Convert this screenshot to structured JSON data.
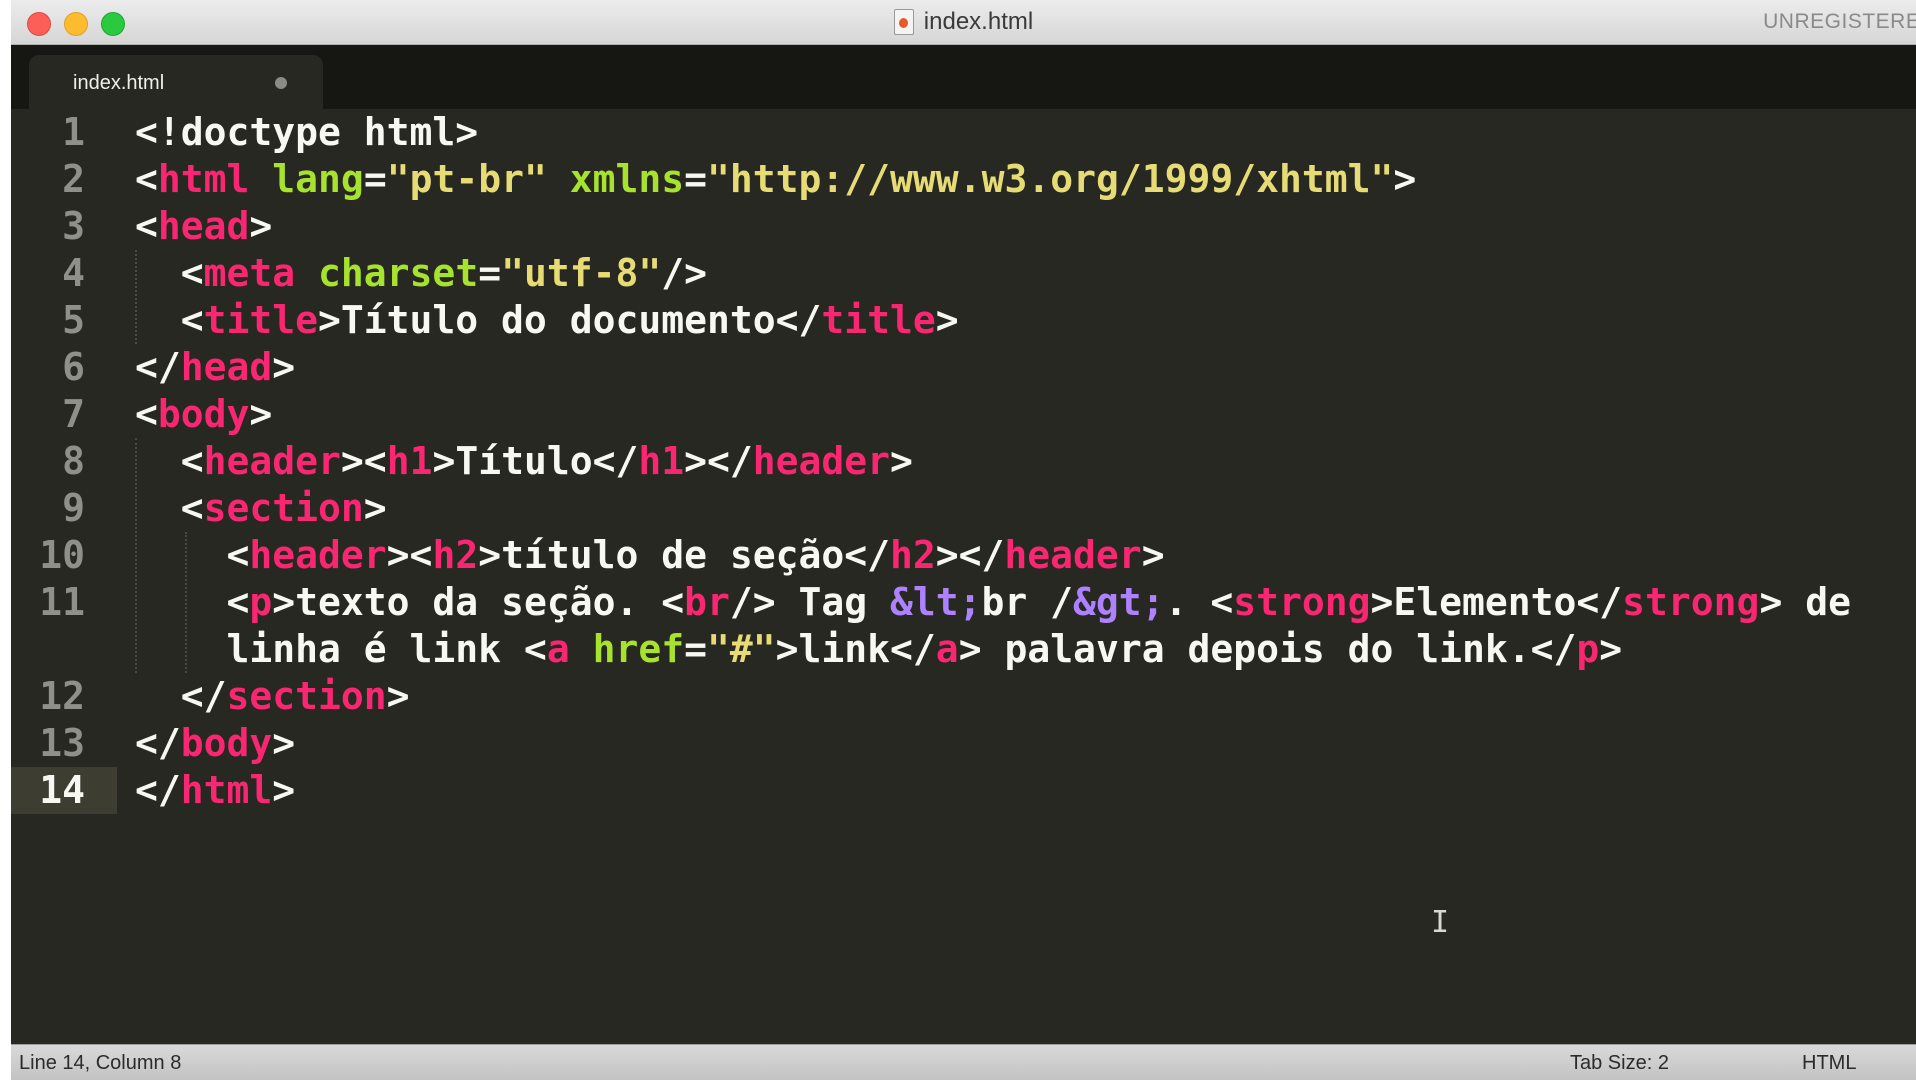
{
  "window": {
    "title": "index.html",
    "registration_label": "UNREGISTERED"
  },
  "tabs": [
    {
      "label": "index.html",
      "modified": true
    }
  ],
  "editor": {
    "active_line": 14,
    "lines": [
      {
        "number": "1",
        "tokens": [
          {
            "t": "<!doctype html>",
            "c": "text"
          }
        ]
      },
      {
        "number": "2",
        "tokens": [
          {
            "t": "<",
            "c": "text"
          },
          {
            "t": "html",
            "c": "tag"
          },
          {
            "t": " ",
            "c": "text"
          },
          {
            "t": "lang",
            "c": "attr"
          },
          {
            "t": "=",
            "c": "text"
          },
          {
            "t": "\"pt-br\"",
            "c": "string"
          },
          {
            "t": " ",
            "c": "text"
          },
          {
            "t": "xmlns",
            "c": "attr"
          },
          {
            "t": "=",
            "c": "text"
          },
          {
            "t": "\"http://www.w3.org/1999/xhtml\"",
            "c": "string"
          },
          {
            "t": ">",
            "c": "text"
          }
        ]
      },
      {
        "number": "3",
        "tokens": [
          {
            "t": "<",
            "c": "text"
          },
          {
            "t": "head",
            "c": "tag"
          },
          {
            "t": ">",
            "c": "text"
          }
        ]
      },
      {
        "number": "4",
        "tokens": [
          {
            "t": "  <",
            "c": "text"
          },
          {
            "t": "meta",
            "c": "tag"
          },
          {
            "t": " ",
            "c": "text"
          },
          {
            "t": "charset",
            "c": "attr"
          },
          {
            "t": "=",
            "c": "text"
          },
          {
            "t": "\"utf-8\"",
            "c": "string"
          },
          {
            "t": "/>",
            "c": "text"
          }
        ]
      },
      {
        "number": "5",
        "tokens": [
          {
            "t": "  <",
            "c": "text"
          },
          {
            "t": "title",
            "c": "tag"
          },
          {
            "t": ">Título do documento</",
            "c": "text"
          },
          {
            "t": "title",
            "c": "tag"
          },
          {
            "t": ">",
            "c": "text"
          }
        ]
      },
      {
        "number": "6",
        "tokens": [
          {
            "t": "</",
            "c": "text"
          },
          {
            "t": "head",
            "c": "tag"
          },
          {
            "t": ">",
            "c": "text"
          }
        ]
      },
      {
        "number": "7",
        "tokens": [
          {
            "t": "<",
            "c": "text"
          },
          {
            "t": "body",
            "c": "tag"
          },
          {
            "t": ">",
            "c": "text"
          }
        ]
      },
      {
        "number": "8",
        "tokens": [
          {
            "t": "  <",
            "c": "text"
          },
          {
            "t": "header",
            "c": "tag"
          },
          {
            "t": "><",
            "c": "text"
          },
          {
            "t": "h1",
            "c": "tag"
          },
          {
            "t": ">Título</",
            "c": "text"
          },
          {
            "t": "h1",
            "c": "tag"
          },
          {
            "t": "></",
            "c": "text"
          },
          {
            "t": "header",
            "c": "tag"
          },
          {
            "t": ">",
            "c": "text"
          }
        ]
      },
      {
        "number": "9",
        "tokens": [
          {
            "t": "  <",
            "c": "text"
          },
          {
            "t": "section",
            "c": "tag"
          },
          {
            "t": ">",
            "c": "text"
          }
        ]
      },
      {
        "number": "10",
        "tokens": [
          {
            "t": "    <",
            "c": "text"
          },
          {
            "t": "header",
            "c": "tag"
          },
          {
            "t": "><",
            "c": "text"
          },
          {
            "t": "h2",
            "c": "tag"
          },
          {
            "t": ">título de seção</",
            "c": "text"
          },
          {
            "t": "h2",
            "c": "tag"
          },
          {
            "t": "></",
            "c": "text"
          },
          {
            "t": "header",
            "c": "tag"
          },
          {
            "t": ">",
            "c": "text"
          }
        ]
      },
      {
        "number": "11",
        "tokens": [
          {
            "t": "    <",
            "c": "text"
          },
          {
            "t": "p",
            "c": "tag"
          },
          {
            "t": ">texto da seção. <",
            "c": "text"
          },
          {
            "t": "br",
            "c": "tag"
          },
          {
            "t": "/> Tag ",
            "c": "text"
          },
          {
            "t": "&lt;",
            "c": "entity"
          },
          {
            "t": "br /",
            "c": "text"
          },
          {
            "t": "&gt;",
            "c": "entity"
          },
          {
            "t": ". <",
            "c": "text"
          },
          {
            "t": "strong",
            "c": "tag"
          },
          {
            "t": ">Elemento</",
            "c": "text"
          },
          {
            "t": "strong",
            "c": "tag"
          },
          {
            "t": "> de",
            "c": "text"
          }
        ],
        "wrap": [
          {
            "t": "    linha é link <",
            "c": "text"
          },
          {
            "t": "a",
            "c": "tag"
          },
          {
            "t": " ",
            "c": "text"
          },
          {
            "t": "href",
            "c": "attr"
          },
          {
            "t": "=",
            "c": "text"
          },
          {
            "t": "\"#\"",
            "c": "string"
          },
          {
            "t": ">link</",
            "c": "text"
          },
          {
            "t": "a",
            "c": "tag"
          },
          {
            "t": "> palavra depois do link.</",
            "c": "text"
          },
          {
            "t": "p",
            "c": "tag"
          },
          {
            "t": ">",
            "c": "text"
          }
        ]
      },
      {
        "number": "12",
        "tokens": [
          {
            "t": "  </",
            "c": "text"
          },
          {
            "t": "section",
            "c": "tag"
          },
          {
            "t": ">",
            "c": "text"
          }
        ]
      },
      {
        "number": "13",
        "tokens": [
          {
            "t": "</",
            "c": "text"
          },
          {
            "t": "body",
            "c": "tag"
          },
          {
            "t": ">",
            "c": "text"
          }
        ]
      },
      {
        "number": "14",
        "tokens": [
          {
            "t": "</",
            "c": "text"
          },
          {
            "t": "html",
            "c": "tag"
          },
          {
            "t": ">",
            "c": "text"
          }
        ]
      }
    ]
  },
  "status_bar": {
    "position": "Line 14, Column 8",
    "tab_size": "Tab Size: 2",
    "syntax": "HTML"
  },
  "colors": {
    "background": "#272822",
    "text": "#f8f8f2",
    "tag": "#f92672",
    "attr": "#a6e22e",
    "string": "#e6db74",
    "entity": "#ae81ff",
    "gutter": "#8f908a"
  }
}
